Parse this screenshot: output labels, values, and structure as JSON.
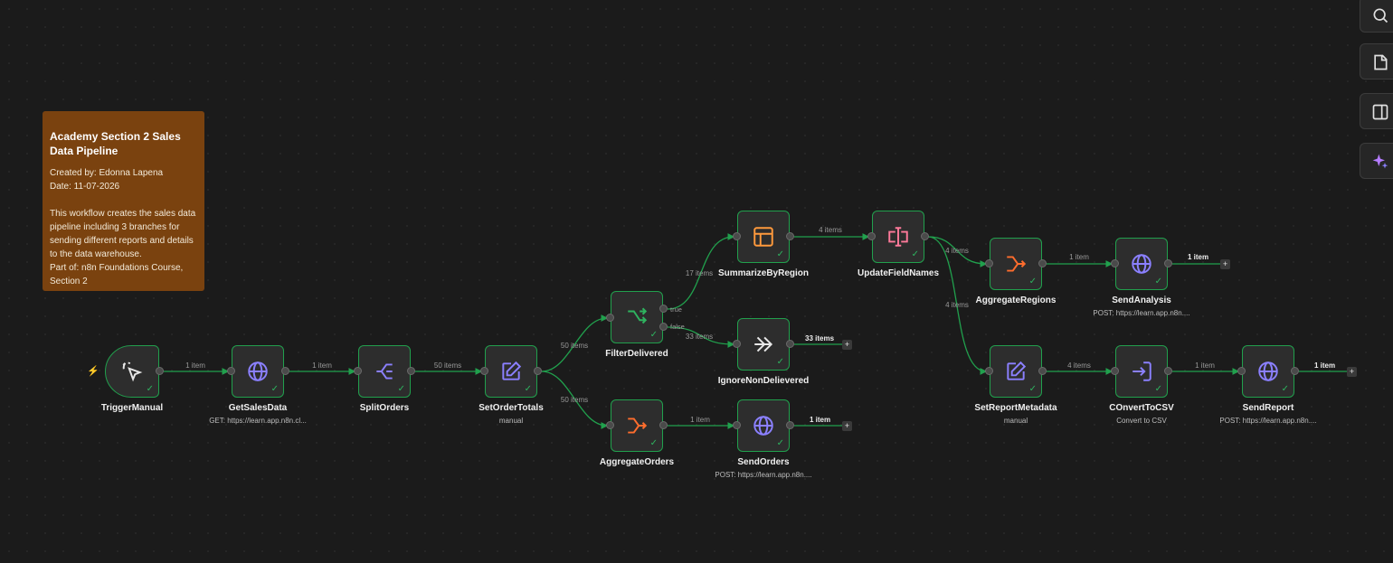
{
  "sticky": {
    "title": "Academy Section 2 Sales Data Pipeline",
    "created_by": "Created by: Edonna Lapena",
    "date": "Date: 11-07-2026",
    "body": "This workflow creates the sales data pipeline including 3 branches for sending different reports and details to the data warehouse.",
    "part_of": "Part of: n8n Foundations Course, Section 2"
  },
  "nodes": {
    "trigger_manual": {
      "label": "TriggerManual",
      "icon": "cursor-click-icon"
    },
    "get_sales_data": {
      "label": "GetSalesData",
      "subtitle": "GET: https://learn.app.n8n.cl...",
      "icon": "globe-icon"
    },
    "split_orders": {
      "label": "SplitOrders",
      "icon": "split-icon"
    },
    "set_order_totals": {
      "label": "SetOrderTotals",
      "subtitle": "manual",
      "icon": "pen-icon"
    },
    "filter_delivered": {
      "label": "FilterDelivered",
      "icon": "filter-icon"
    },
    "summarize_by_region": {
      "label": "SummarizeByRegion",
      "icon": "table-icon"
    },
    "ignore_non_delievered": {
      "label": "IgnoreNonDelievered",
      "icon": "double-arrow-icon"
    },
    "aggregate_orders": {
      "label": "AggregateOrders",
      "icon": "aggregate-icon"
    },
    "send_orders": {
      "label": "SendOrders",
      "subtitle": "POST: https://learn.app.n8n....",
      "icon": "globe-icon"
    },
    "update_field_names": {
      "label": "UpdateFieldNames",
      "icon": "rename-icon"
    },
    "aggregate_regions": {
      "label": "AggregateRegions",
      "icon": "aggregate-icon"
    },
    "send_analysis": {
      "label": "SendAnalysis",
      "subtitle": "POST: https://learn.app.n8n....",
      "icon": "globe-icon"
    },
    "set_report_metadata": {
      "label": "SetReportMetadata",
      "subtitle": "manual",
      "icon": "pen-icon"
    },
    "convert_to_csv": {
      "label": "COnvertToCSV",
      "subtitle": "Convert to CSV",
      "icon": "export-icon"
    },
    "send_report": {
      "label": "SendReport",
      "subtitle": "POST: https://learn.app.n8n....",
      "icon": "globe-icon"
    }
  },
  "edges": {
    "trigger_to_get": "1 item",
    "get_to_split": "1 item",
    "split_to_set": "50 items",
    "set_to_filter": "50 items",
    "set_to_aggregate": "50 items",
    "filter_true_to_summarize": "17 items",
    "filter_false_to_ignore": "33 items",
    "aggregate_to_send_orders": "1 item",
    "summarize_to_update": "4 items",
    "update_to_aggregate_regions": "4 items",
    "update_to_set_report": "4 items",
    "aggregate_regions_to_send_analysis": "1 item",
    "set_report_to_convert": "4 items",
    "convert_to_send_report": "1 item"
  },
  "branches": {
    "true_label": "true",
    "false_label": "false"
  },
  "end_counts": {
    "ignore": "33 items",
    "send_orders": "1 item",
    "send_analysis": "1 item",
    "send_report": "1 item"
  },
  "add_label": "+",
  "toolbar": {
    "search": "search-icon",
    "sticky": "sticky-note-icon",
    "panel": "panel-icon",
    "ai": "sparkle-icon"
  },
  "colors": {
    "connection": "#21a04d",
    "sticky": "#7a420f",
    "icon_purple": "#8b80ff",
    "icon_orange": "#ff6d2d",
    "icon_pink": "#ff7a9a"
  }
}
